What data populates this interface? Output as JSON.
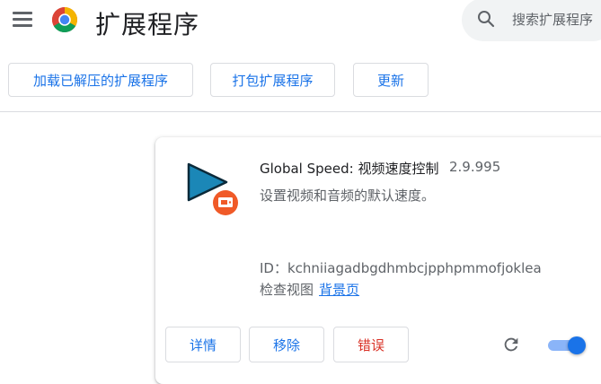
{
  "header": {
    "title": "扩展程序",
    "search_placeholder": "搜索扩展程序",
    "icons": [
      "menu-icon",
      "chrome-logo",
      "search-icon"
    ]
  },
  "toolbar": {
    "load_unpacked": "加载已解压的扩展程序",
    "pack_extension": "打包扩展程序",
    "update": "更新"
  },
  "extension": {
    "name": "Global Speed: 视频速度控制",
    "version": "2.9.995",
    "description": "设置视频和音频的默认速度。",
    "id_label": "ID：",
    "id_value": "kchniiagadbgdhmbcjpphpmmofjoklea",
    "inspect_label": "检查视图",
    "inspect_link": "背景页",
    "details_button": "详情",
    "remove_button": "移除",
    "errors_button": "错误",
    "enabled": true
  },
  "colors": {
    "accent": "#1a73e8",
    "error": "#d93025",
    "icon_blue": "#1b87b7",
    "badge_orange": "#f05a28"
  }
}
